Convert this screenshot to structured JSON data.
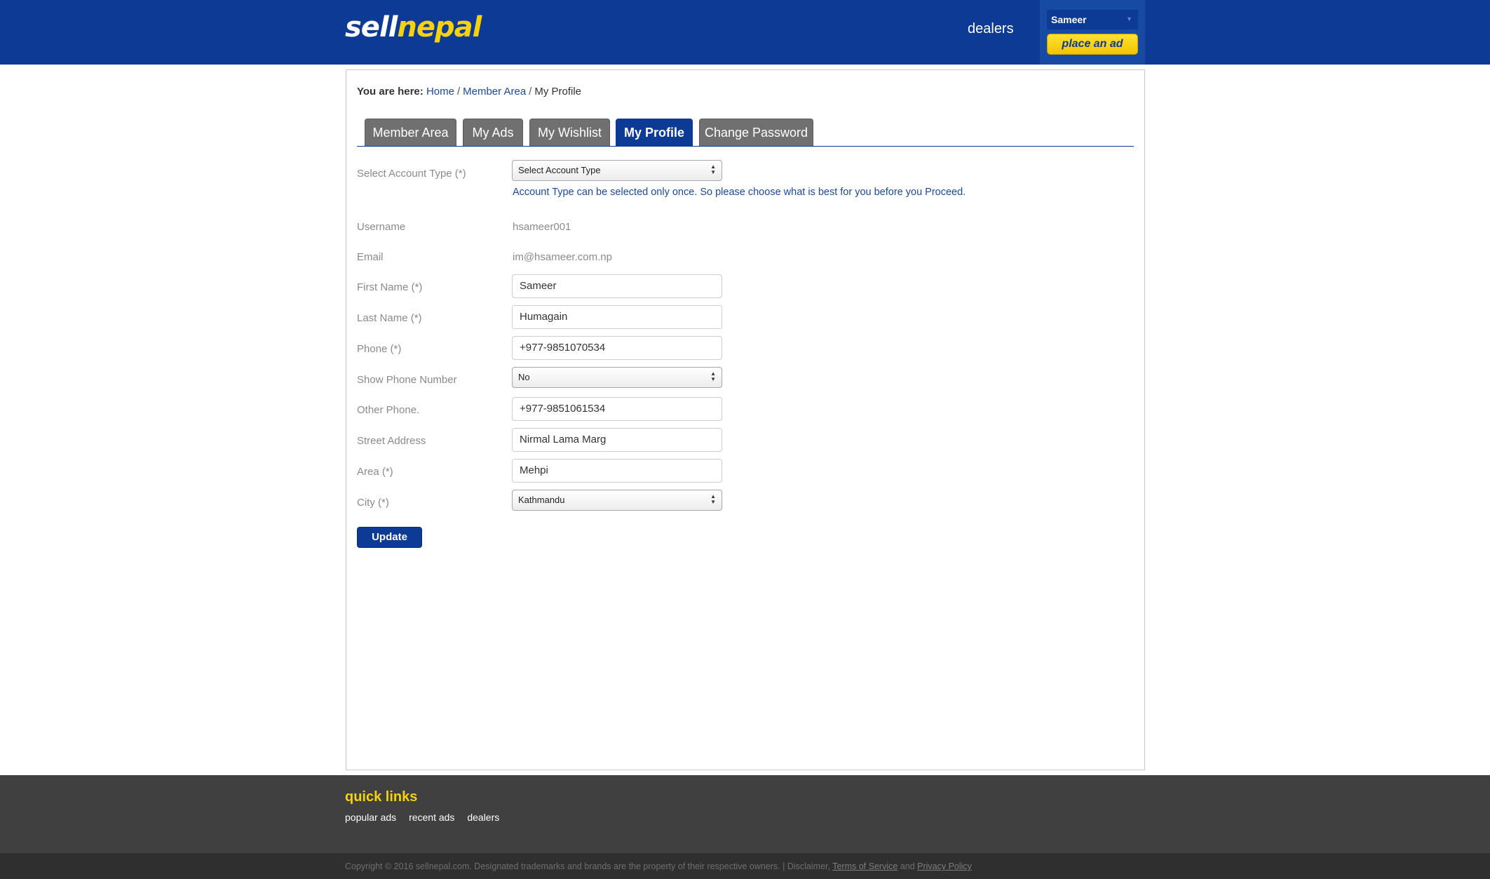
{
  "header": {
    "logo_part1": "sell",
    "logo_part2": "nepal",
    "dealers_link": "dealers",
    "user_name": "Sameer",
    "place_ad": "place an ad"
  },
  "breadcrumb": {
    "prefix": "You are here:",
    "items": [
      "Home",
      "Member Area",
      "My Profile"
    ]
  },
  "tabs": [
    "Member Area",
    "My Ads",
    "My Wishlist",
    "My Profile",
    "Change Password"
  ],
  "active_tab": "My Profile",
  "form": {
    "account_type": {
      "label": "Select Account Type (*)",
      "value": "Select Account Type"
    },
    "account_note": "Account Type can be selected only once. So please choose what is best for you before you Proceed.",
    "username": {
      "label": "Username",
      "value": "hsameer001"
    },
    "email": {
      "label": "Email",
      "value": "im@hsameer.com.np"
    },
    "first_name": {
      "label": "First Name (*)",
      "value": "Sameer"
    },
    "last_name": {
      "label": "Last Name (*)",
      "value": "Humagain"
    },
    "phone": {
      "label": "Phone (*)",
      "value": "+977-9851070534"
    },
    "show_phone": {
      "label": "Show Phone Number",
      "value": "No"
    },
    "other_phone": {
      "label": "Other Phone.",
      "value": "+977-9851061534"
    },
    "street": {
      "label": "Street Address",
      "value": "Nirmal Lama Marg"
    },
    "area": {
      "label": "Area (*)",
      "value": "Mehpi"
    },
    "city": {
      "label": "City (*)",
      "value": "Kathmandu"
    },
    "submit": "Update"
  },
  "footer": {
    "quick_links_title": "quick links",
    "links": [
      "popular ads",
      "recent ads",
      "dealers"
    ],
    "copyright": "Copyright © 2016 sellnepal.com. Designated trademarks and brands are the property of their respective owners. | Disclaimer,",
    "terms": "Terms of Service",
    "and": "and",
    "privacy": "Privacy Policy"
  },
  "colors": {
    "brand_blue": "#0c3a95",
    "brand_yellow": "#f5d10f",
    "tab_gray": "#707070",
    "footer_dark": "#404040"
  }
}
